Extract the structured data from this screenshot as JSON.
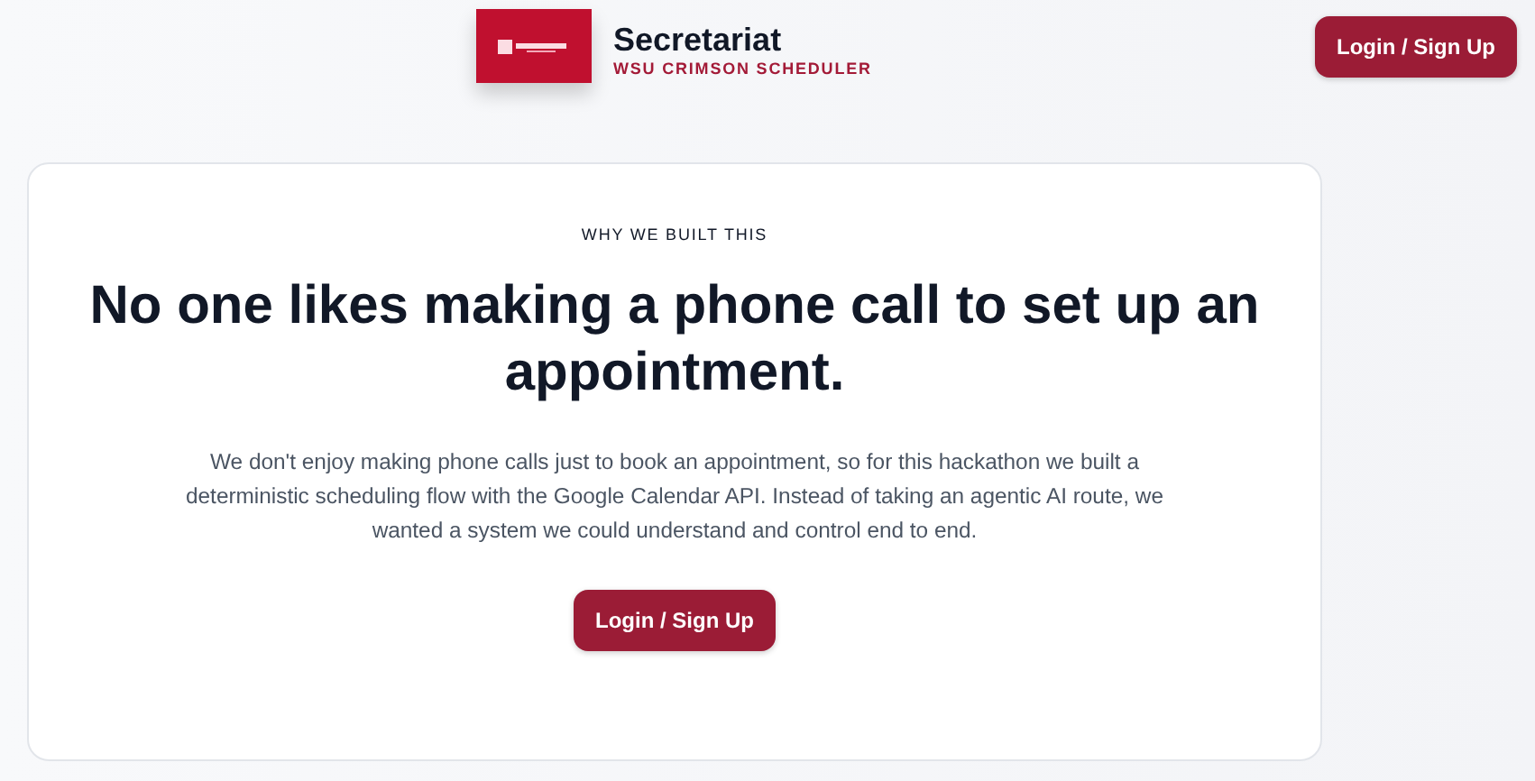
{
  "header": {
    "brand": {
      "title": "Secretariat",
      "subtitle": "WSU CRIMSON SCHEDULER"
    },
    "login_button": "Login / Sign Up"
  },
  "card": {
    "eyebrow": "WHY WE BUILT THIS",
    "heading": "No one likes making a phone call to set up an appointment.",
    "paragraph": "We don't enjoy making phone calls just to book an appointment, so for this hackathon we built a deterministic scheduling flow with the Google Calendar API. Instead of taking an agentic AI route, we wanted a system we could understand and control end to end.",
    "button": "Login / Sign Up"
  }
}
